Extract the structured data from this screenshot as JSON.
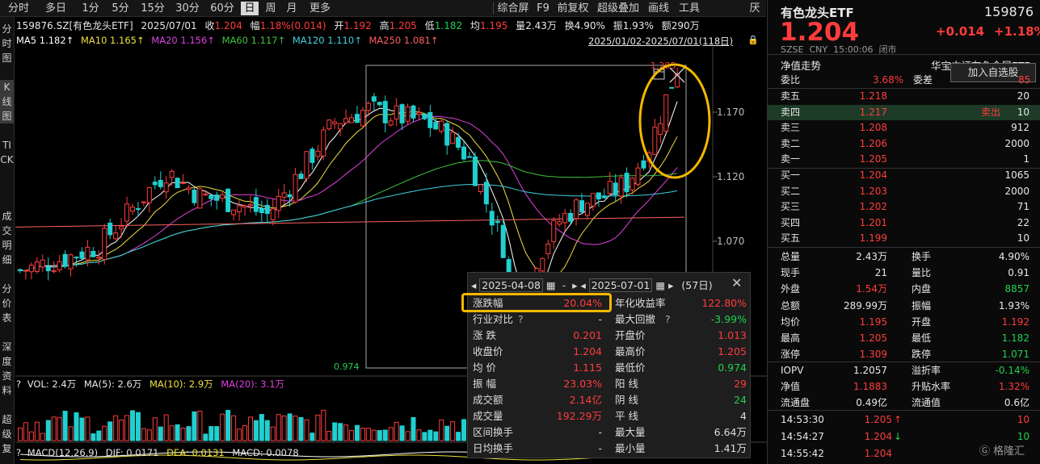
{
  "toolbar": {
    "tabs": [
      "分时",
      "多日",
      "1分",
      "5分",
      "15分",
      "30分",
      "60分",
      "日",
      "周",
      "月",
      "更多"
    ],
    "actions": [
      "综合屏",
      "F9",
      "前复权",
      "超级叠加",
      "画线",
      "工具"
    ],
    "corner": "厌"
  },
  "left_tabs": [
    "分时图",
    "K线图",
    "TICK",
    "成交明细",
    "分价表",
    "深度资料",
    "超级复"
  ],
  "info": {
    "code_name": "159876.SZ[有色龙头ETF]",
    "date": "2025/07/01",
    "close_label": "收",
    "close": "1.204",
    "change_label": "幅",
    "change": "1.18%(0.014)",
    "open_label": "开",
    "open": "1.192",
    "high_label": "高",
    "high": "1.205",
    "low_label": "低",
    "low": "1.182",
    "avg_label": "均",
    "avg": "1.195",
    "vol_label": "量",
    "vol": "2.43万",
    "turnover_label": "换",
    "turnover": "4.90%",
    "amp_label": "振",
    "amp": "1.93%",
    "amount_label": "额",
    "amount": "290万"
  },
  "ma": {
    "ma5": "MA5 1.182↑",
    "ma10": "MA10 1.165↑",
    "ma20": "MA20 1.156↑",
    "ma60": "MA60 1.117↑",
    "ma120": "MA120 1.110↑",
    "ma250": "MA250 1.081↑"
  },
  "date_range": "2025/01/02-2025/07/01(118日)",
  "chart": {
    "y_ticks": [
      "1.170",
      "1.120",
      "1.070"
    ],
    "max_label": "1.205",
    "min_label": "0.974"
  },
  "volume": {
    "label": "VOL: 2.4万",
    "ma5": "MA(5): 2.6万",
    "ma10": "MA(10): 2.9万",
    "ma20": "MA(20): 3.1万"
  },
  "macd": {
    "label": "MACD(12,26,9)",
    "dif": "DIF: 0.0171",
    "dea": "DEA: 0.0131",
    "macd": "MACD: 0.0078"
  },
  "popup": {
    "start": "2025-04-08",
    "dash": "-",
    "end": "2025-07-01",
    "days": "(57日)",
    "rows": [
      {
        "l1": "涨跌幅",
        "v1": "20.04%",
        "l2": "年化收益率",
        "v2": "122.80%"
      },
      {
        "l1": "行业对比",
        "v1": "-",
        "l2": "最大回撤",
        "v2": "-3.99%"
      },
      {
        "l1": "涨    跌",
        "v1": "0.201",
        "l2": "开盘价",
        "v2": "1.013"
      },
      {
        "l1": "收盘价",
        "v1": "1.204",
        "l2": "最高价",
        "v2": "1.205"
      },
      {
        "l1": "均    价",
        "v1": "1.115",
        "l2": "最低价",
        "v2": "0.974"
      },
      {
        "l1": "振    幅",
        "v1": "23.03%",
        "l2": "阳    线",
        "v2": "29"
      },
      {
        "l1": "成交额",
        "v1": "2.14亿",
        "l2": "阴    线",
        "v2": "24"
      },
      {
        "l1": "成交量",
        "v1": "192.29万",
        "l2": "平    线",
        "v2": "4"
      },
      {
        "l1": "区间换手",
        "v1": "-",
        "l2": "最大量",
        "v2": "6.64万"
      },
      {
        "l1": "日均换手",
        "v1": "-",
        "l2": "最小量",
        "v2": "1.41万"
      }
    ]
  },
  "quote": {
    "name": "有色龙头ETF",
    "code": "159876",
    "price": "1.204",
    "change": "+0.014",
    "pct": "+1.18%",
    "market": "SZSE  CNY  15:00:06  闭市",
    "nav_trend": "净值走势",
    "fund_name": "华宝中证有色金属ETF",
    "add_watch": "加入自选股",
    "weibi_label": "委比",
    "weibi": "3.68%",
    "weicha_label": "委差",
    "weicha": "85",
    "sells": [
      {
        "label": "卖五",
        "price": "1.218",
        "tag": "",
        "vol": "20"
      },
      {
        "label": "卖四",
        "price": "1.217",
        "tag": "卖出",
        "vol": "10"
      },
      {
        "label": "卖三",
        "price": "1.208",
        "tag": "",
        "vol": "912"
      },
      {
        "label": "卖二",
        "price": "1.206",
        "tag": "",
        "vol": "2000"
      },
      {
        "label": "卖一",
        "price": "1.205",
        "tag": "",
        "vol": "1"
      }
    ],
    "buys": [
      {
        "label": "买一",
        "price": "1.204",
        "vol": "1065"
      },
      {
        "label": "买二",
        "price": "1.203",
        "vol": "2000"
      },
      {
        "label": "买三",
        "price": "1.202",
        "vol": "71"
      },
      {
        "label": "买四",
        "price": "1.201",
        "vol": "22"
      },
      {
        "label": "买五",
        "price": "1.199",
        "vol": "10"
      }
    ],
    "stats": [
      {
        "l1": "总量",
        "v1": "2.43万",
        "c1": "white",
        "l2": "换手",
        "v2": "4.90%",
        "c2": "white"
      },
      {
        "l1": "现手",
        "v1": "21",
        "c1": "white",
        "l2": "量比",
        "v2": "0.91",
        "c2": "white"
      },
      {
        "l1": "外盘",
        "v1": "1.54万",
        "c1": "red",
        "l2": "内盘",
        "v2": "8857",
        "c2": "green"
      },
      {
        "l1": "总额",
        "v1": "289.99万",
        "c1": "white",
        "l2": "振幅",
        "v2": "1.93%",
        "c2": "white"
      },
      {
        "l1": "均价",
        "v1": "1.195",
        "c1": "red",
        "l2": "开盘",
        "v2": "1.192",
        "c2": "red"
      },
      {
        "l1": "最高",
        "v1": "1.205",
        "c1": "red",
        "l2": "最低",
        "v2": "1.182",
        "c2": "green"
      },
      {
        "l1": "涨停",
        "v1": "1.309",
        "c1": "red",
        "l2": "跌停",
        "v2": "1.071",
        "c2": "green"
      }
    ],
    "stats2": [
      {
        "l1": "IOPV",
        "v1": "1.2057",
        "c1": "white",
        "l2": "溢折率",
        "v2": "-0.14%",
        "c2": "green"
      },
      {
        "l1": "净值",
        "v1": "1.1883",
        "c1": "red",
        "l2": "升贴水率",
        "v2": "1.32%",
        "c2": "red"
      },
      {
        "l1": "流通盘",
        "v1": "0.49亿",
        "c1": "white",
        "l2": "流通值",
        "v2": "0.6亿",
        "c2": "white"
      }
    ],
    "ticks": [
      {
        "time": "14:53:30",
        "price": "1.205",
        "arrow": "↑",
        "vol": "10",
        "dir": "up"
      },
      {
        "time": "14:54:27",
        "price": "1.204",
        "arrow": "↓",
        "vol": "10",
        "dir": "down"
      },
      {
        "time": "14:55:42",
        "price": "1.204",
        "arrow": "",
        "vol": "",
        "dir": "none"
      }
    ],
    "watermark": "格隆汇"
  },
  "colors": {
    "up": "#ff3c3c",
    "down": "#20d0d0",
    "highlight": "#f5b800",
    "ma5": "#ffffff",
    "ma10": "#f0e040",
    "ma20": "#e040e0",
    "ma60": "#40c040",
    "ma120": "#40d0e0",
    "ma250": "#ff6060"
  }
}
